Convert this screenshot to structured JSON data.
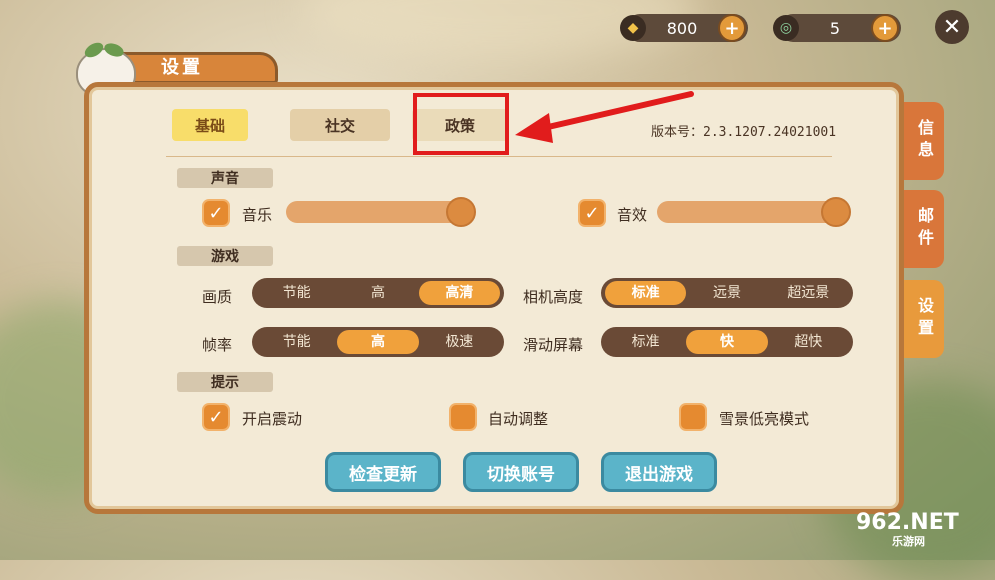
{
  "currencies": [
    {
      "icon": "coin-icon",
      "value": "800"
    },
    {
      "icon": "gem-icon",
      "value": "5"
    }
  ],
  "title": "设置",
  "tabs": [
    {
      "label": "基础",
      "active": true
    },
    {
      "label": "社交",
      "active": false
    },
    {
      "label": "政策",
      "active": false
    }
  ],
  "version": "版本号：2.3.1207.24021001",
  "sections": {
    "sound": "声音",
    "game": "游戏",
    "tips": "提示"
  },
  "sound": {
    "music_label": "音乐",
    "music_checked": true,
    "music_level": 1.0,
    "sfx_label": "音效",
    "sfx_checked": true,
    "sfx_level": 1.0
  },
  "game": {
    "quality_label": "画质",
    "quality_options": [
      "节能",
      "高",
      "高清"
    ],
    "quality_selected": "高清",
    "camera_label": "相机高度",
    "camera_options": [
      "标准",
      "远景",
      "超远景"
    ],
    "camera_selected": "标准",
    "framerate_label": "帧率",
    "framerate_options": [
      "节能",
      "高",
      "极速"
    ],
    "framerate_selected": "高",
    "scroll_label": "滑动屏幕",
    "scroll_options": [
      "标准",
      "快",
      "超快"
    ],
    "scroll_selected": "快"
  },
  "tips": {
    "vibration_label": "开启震动",
    "vibration_checked": true,
    "auto_adjust_label": "自动调整",
    "auto_adjust_checked": false,
    "snow_mode_label": "雪景低亮模式",
    "snow_mode_checked": false
  },
  "buttons": {
    "check_update": "检查更新",
    "switch_account": "切换账号",
    "exit_game": "退出游戏"
  },
  "side_tabs": [
    {
      "label": "信息",
      "color": "#d9763a"
    },
    {
      "label": "邮件",
      "color": "#d9763a"
    },
    {
      "label": "设置",
      "color": "#e89a3c"
    }
  ],
  "watermark": {
    "main": "962.NET",
    "sub": "乐游网"
  },
  "colors": {
    "accent": "#f0a13c",
    "panel": "#f3ead6",
    "highlight": "#e11c1c"
  }
}
